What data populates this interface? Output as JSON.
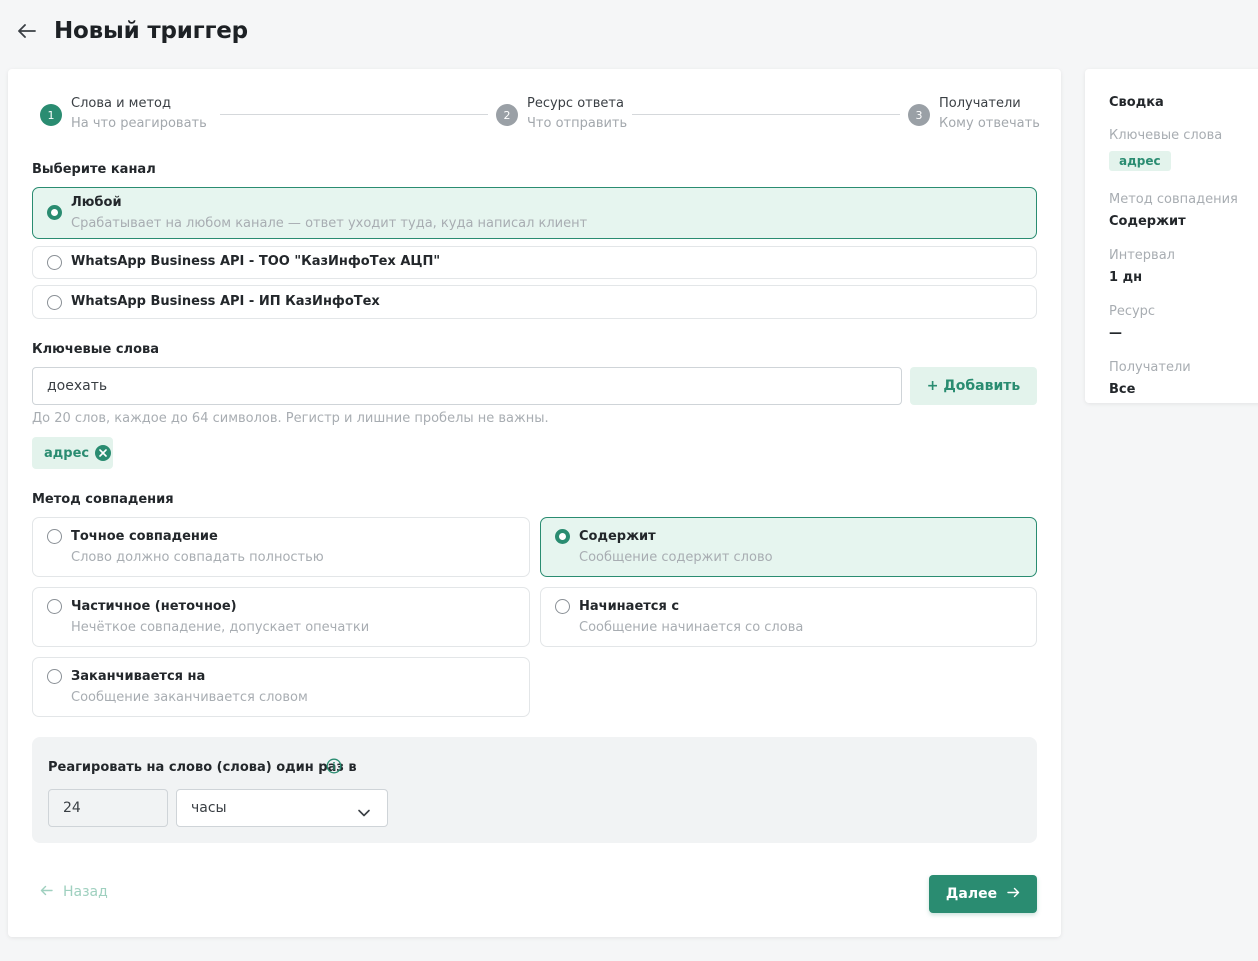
{
  "page": {
    "title": "Новый триггер"
  },
  "stepper": {
    "steps": [
      {
        "number": "1",
        "title": "Слова и метод",
        "subtitle": "На что реагировать"
      },
      {
        "number": "2",
        "title": "Ресурс ответа",
        "subtitle": "Что отправить"
      },
      {
        "number": "3",
        "title": "Получатели",
        "subtitle": "Кому отвечать"
      }
    ]
  },
  "channel": {
    "label": "Выберите канал",
    "options": [
      {
        "title": "Любой",
        "subtitle": "Срабатывает на любом канале — ответ уходит туда, куда написал клиент",
        "selected": true
      },
      {
        "title": "WhatsApp Business API - ТОО \"КазИнфоТех АЦП\""
      },
      {
        "title": "WhatsApp Business API - ИП КазИнфоТех"
      }
    ]
  },
  "keywords": {
    "label": "Ключевые слова",
    "input_value": "доехать",
    "add_label": "+ Добавить",
    "hint": "До 20 слов, каждое до 64 символов. Регистр и лишние пробелы не важны.",
    "chips": [
      "адрес"
    ]
  },
  "match": {
    "label": "Метод совпадения",
    "options": [
      {
        "title": "Точное совпадение",
        "subtitle": "Слово должно совпадать полностью"
      },
      {
        "title": "Содержит",
        "subtitle": "Сообщение содержит слово",
        "selected": true
      },
      {
        "title": "Частичное (неточное)",
        "subtitle": "Нечёткое совпадение, допускает опечатки"
      },
      {
        "title": "Начинается с",
        "subtitle": "Сообщение начинается со слова"
      },
      {
        "title": "Заканчивается на",
        "subtitle": "Сообщение заканчивается словом"
      }
    ]
  },
  "interval": {
    "label": "Реагировать на слово (слова) один раз в",
    "number_value": "24",
    "unit_value": "часы"
  },
  "footer": {
    "back_label": "Назад",
    "next_label": "Далее"
  },
  "summary": {
    "title": "Сводка",
    "keywords_label": "Ключевые слова",
    "keywords_chip": "адрес",
    "method_label": "Метод совпадения",
    "method_value": "Содержит",
    "interval_label": "Интервал",
    "interval_value": "1 дн",
    "resource_label": "Ресурс",
    "resource_value": "—",
    "recipients_label": "Получатели",
    "recipients_value": "Все"
  },
  "colors": {
    "accent": "#2a8c71",
    "accent_light": "#e6f5ef",
    "muted_text": "#a8adb2"
  }
}
